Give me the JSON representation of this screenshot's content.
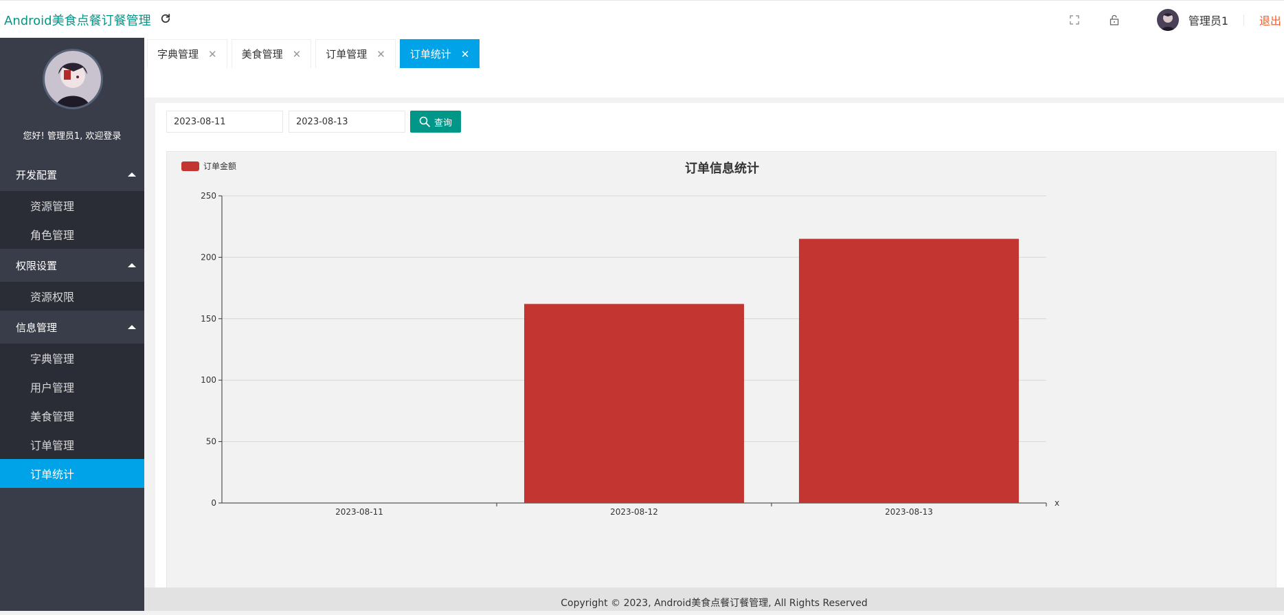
{
  "header": {
    "app_title": "Android美食点餐订餐管理",
    "user_name": "管理员1",
    "logout_label": "退出"
  },
  "sidebar": {
    "welcome": "您好! 管理员1, 欢迎登录",
    "groups": [
      {
        "title": "开发配置",
        "items": [
          "资源管理",
          "角色管理"
        ]
      },
      {
        "title": "权限设置",
        "items": [
          "资源权限"
        ]
      },
      {
        "title": "信息管理",
        "items": [
          "字典管理",
          "用户管理",
          "美食管理",
          "订单管理",
          "订单统计"
        ]
      }
    ],
    "active_item": "订单统计"
  },
  "tabs": [
    {
      "label": "字典管理",
      "active": false
    },
    {
      "label": "美食管理",
      "active": false
    },
    {
      "label": "订单管理",
      "active": false
    },
    {
      "label": "订单统计",
      "active": true
    }
  ],
  "filters": {
    "start_date": "2023-08-11",
    "end_date": "2023-08-13",
    "search_label": "查询"
  },
  "chart_data": {
    "type": "bar",
    "title": "订单信息统计",
    "categories": [
      "2023-08-11",
      "2023-08-12",
      "2023-08-13"
    ],
    "series": [
      {
        "name": "订单金额",
        "values": [
          0,
          162,
          215
        ],
        "color": "#c23531"
      }
    ],
    "xlabel": "x",
    "ylabel": "",
    "ylim": [
      0,
      250
    ],
    "yticks": [
      0,
      50,
      100,
      150,
      200,
      250
    ],
    "grid": true,
    "legend": "top-left"
  },
  "footer": {
    "copyright": "Copyright © 2023, Android美食点餐订餐管理, All Rights Reserved"
  },
  "colors": {
    "accent": "#009688",
    "active_blue": "#00a2e8",
    "logout": "#ff5722",
    "bar": "#c23531"
  }
}
